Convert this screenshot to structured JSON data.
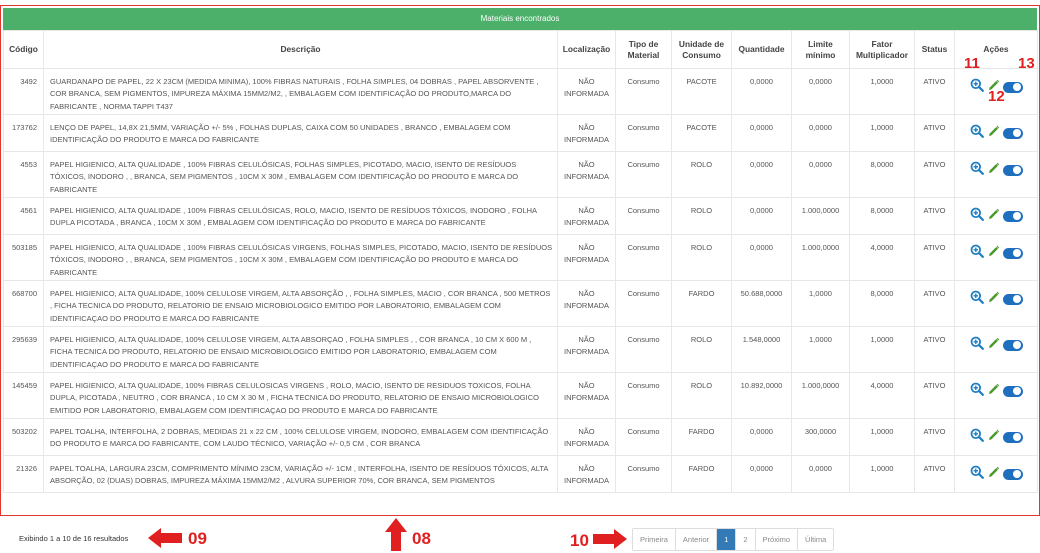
{
  "banner_title": "Materiais encontrados",
  "headers": {
    "codigo": "Código",
    "descricao": "Descrição",
    "localizacao": "Localização",
    "tipo": "Tipo de Material",
    "unidade": "Unidade de Consumo",
    "quantidade": "Quantidade",
    "limite": "Limite mínimo",
    "fator": "Fator Multiplicador",
    "status": "Status",
    "acoes": "Ações"
  },
  "rows": [
    {
      "codigo": "3492",
      "descricao": "GUARDANAPO DE PAPEL, 22 X 23CM (MEDIDA MINIMA), 100% FIBRAS NATURAIS , FOLHA SIMPLES, 04 DOBRAS , PAPEL ABSORVENTE , COR BRANCA, SEM PIGMENTOS, IMPUREZA MÁXIMA 15MM2/M2, , EMBALAGEM COM IDENTIFICAÇÃO DO PRODUTO,MARCA DO FABRICANTE , NORMA TAPPI T437",
      "localizacao": "NÃO INFORMADA",
      "tipo": "Consumo",
      "unidade": "PACOTE",
      "quantidade": "0,0000",
      "limite": "0,0000",
      "fator": "1,0000",
      "status": "ATIVO"
    },
    {
      "codigo": "173762",
      "descricao": "LENÇO DE PAPEL, 14,8X 21,5MM, VARIAÇÃO +/- 5% , FOLHAS DUPLAS, CAIXA COM 50 UNIDADES , BRANCO , EMBALAGEM COM IDENTIFICAÇÃO DO PRODUTO E MARCA DO FABRICANTE",
      "localizacao": "NÃO INFORMADA",
      "tipo": "Consumo",
      "unidade": "PACOTE",
      "quantidade": "0,0000",
      "limite": "0,0000",
      "fator": "1,0000",
      "status": "ATIVO"
    },
    {
      "codigo": "4553",
      "descricao": "PAPEL HIGIENICO, ALTA QUALIDADE , 100% FIBRAS CELULÓSICAS, FOLHAS SIMPLES, PICOTADO, MACIO, ISENTO DE RESÍDUOS TÓXICOS, INODORO , , BRANCA, SEM PIGMENTOS , 10CM X 30M , EMBALAGEM COM IDENTIFICAÇÃO DO PRODUTO E MARCA DO FABRICANTE",
      "localizacao": "NÃO INFORMADA",
      "tipo": "Consumo",
      "unidade": "ROLO",
      "quantidade": "0,0000",
      "limite": "0,0000",
      "fator": "8,0000",
      "status": "ATIVO"
    },
    {
      "codigo": "4561",
      "descricao": "PAPEL HIGIENICO, ALTA QUALIDADE , 100% FIBRAS CELULÓSICAS, ROLO, MACIO, ISENTO DE RESÍDUOS TÓXICOS, INODORO , FOLHA DUPLA PICOTADA , BRANCA , 10CM X 30M , EMBALAGEM COM IDENTIFICAÇÃO DO PRODUTO E MARCA DO FABRICANTE",
      "localizacao": "NÃO INFORMADA",
      "tipo": "Consumo",
      "unidade": "ROLO",
      "quantidade": "0,0000",
      "limite": "1.000,0000",
      "fator": "8,0000",
      "status": "ATIVO"
    },
    {
      "codigo": "503185",
      "descricao": "PAPEL HIGIENICO, ALTA QUALIDADE , 100% FIBRAS CELULÓSICAS VIRGENS, FOLHAS SIMPLES, PICOTADO, MACIO, ISENTO DE RESÍDUOS TÓXICOS, INODORO , , BRANCA, SEM PIGMENTOS , 10CM X 30M , EMBALAGEM COM IDENTIFICAÇÃO DO PRODUTO E MARCA DO FABRICANTE",
      "localizacao": "NÃO INFORMADA",
      "tipo": "Consumo",
      "unidade": "ROLO",
      "quantidade": "0,0000",
      "limite": "1.000,0000",
      "fator": "4,0000",
      "status": "ATIVO"
    },
    {
      "codigo": "668700",
      "descricao": "PAPEL HIGIENICO, ALTA QUALIDADE, 100% CELULOSE VIRGEM, ALTA ABSORÇÃO , , FOLHA SIMPLES, MACIO , COR BRANCA , 500 METROS , FICHA TECNICA DO PRODUTO, RELATORIO DE ENSAIO MICROBIOLOGICO EMITIDO POR LABORATORIO, EMBALAGEM COM IDENTIFICAÇAO DO PRODUTO E MARCA DO FABRICANTE",
      "localizacao": "NÃO INFORMADA",
      "tipo": "Consumo",
      "unidade": "FARDO",
      "quantidade": "50.688,0000",
      "limite": "1,0000",
      "fator": "8,0000",
      "status": "ATIVO"
    },
    {
      "codigo": "295639",
      "descricao": "PAPEL HIGIENICO, ALTA QUALIDADE, 100% CELULOSE VIRGEM, ALTA ABSORÇAO , FOLHA SIMPLES , , COR BRANCA , 10 CM X 600 M , FICHA TECNICA DO PRODUTO, RELATORIO DE ENSAIO MICROBIOLOGICO EMITIDO POR LABORATORIO, EMBALAGEM COM IDENTIFICAÇAO DO PRODUTO E MARCA DO FABRICANTE",
      "localizacao": "NÃO INFORMADA",
      "tipo": "Consumo",
      "unidade": "ROLO",
      "quantidade": "1.548,0000",
      "limite": "1,0000",
      "fator": "1,0000",
      "status": "ATIVO"
    },
    {
      "codigo": "145459",
      "descricao": "PAPEL HIGIENICO, ALTA QUALIDADE, 100% FIBRAS CELULOSICAS VIRGENS , ROLO, MACIO, ISENTO DE RESIDUOS TOXICOS, FOLHA DUPLA, PICOTADA , NEUTRO , COR BRANCA , 10 CM X 30 M , FICHA TECNICA DO PRODUTO, RELATORIO DE ENSAIO MICROBIOLOGICO EMITIDO POR LABORATORIO, EMBALAGEM COM IDENTIFICAÇAO DO PRODUTO E MARCA DO FABRICANTE",
      "localizacao": "NÃO INFORMADA",
      "tipo": "Consumo",
      "unidade": "ROLO",
      "quantidade": "10.892,0000",
      "limite": "1.000,0000",
      "fator": "4,0000",
      "status": "ATIVO"
    },
    {
      "codigo": "503202",
      "descricao": "PAPEL TOALHA, INTERFOLHA, 2 DOBRAS, MEDIDAS 21 x 22 CM , 100% CELULOSE VIRGEM, INODORO, EMBALAGEM COM IDENTIFICAÇÃO DO PRODUTO E MARCA DO FABRICANTE, COM LAUDO TÉCNICO, VARIAÇÃO +/- 0,5 CM , COR BRANCA",
      "localizacao": "NÃO INFORMADA",
      "tipo": "Consumo",
      "unidade": "FARDO",
      "quantidade": "0,0000",
      "limite": "300,0000",
      "fator": "1,0000",
      "status": "ATIVO"
    },
    {
      "codigo": "21326",
      "descricao": "PAPEL TOALHA, LARGURA 23CM, COMPRIMENTO MÍNIMO 23CM, VARIAÇÃO +/- 1CM , INTERFOLHA, ISENTO DE RESÍDUOS TÓXICOS, ALTA ABSORÇÃO, 02 (DUAS) DOBRAS, IMPUREZA MÁXIMA 15MM2/M2 , ALVURA SUPERIOR 70%, COR BRANCA, SEM PIGMENTOS",
      "localizacao": "NÃO INFORMADA",
      "tipo": "Consumo",
      "unidade": "FARDO",
      "quantidade": "0,0000",
      "limite": "0,0000",
      "fator": "1,0000",
      "status": "ATIVO"
    }
  ],
  "footer": {
    "results": "Exibindo 1 a 10 de 16 resultados"
  },
  "pagination": {
    "first": "Primeira",
    "prev": "Anterior",
    "page1": "1",
    "page2": "2",
    "next": "Próximo",
    "last": "Última"
  },
  "annotations": {
    "a08": "08",
    "a09": "09",
    "a10": "10",
    "a11": "11",
    "a12": "12",
    "a13": "13"
  },
  "colors": {
    "banner": "#4caf6a",
    "annotation_red": "#e02020",
    "zoom_icon": "#1f7fc4",
    "edit_icon": "#4a9a2a",
    "toggle": "#1f6fbf",
    "active_page": "#337ab7"
  },
  "icons": {
    "zoom": "zoom-in-icon",
    "edit": "pencil-icon",
    "toggle": "toggle-on-icon"
  }
}
